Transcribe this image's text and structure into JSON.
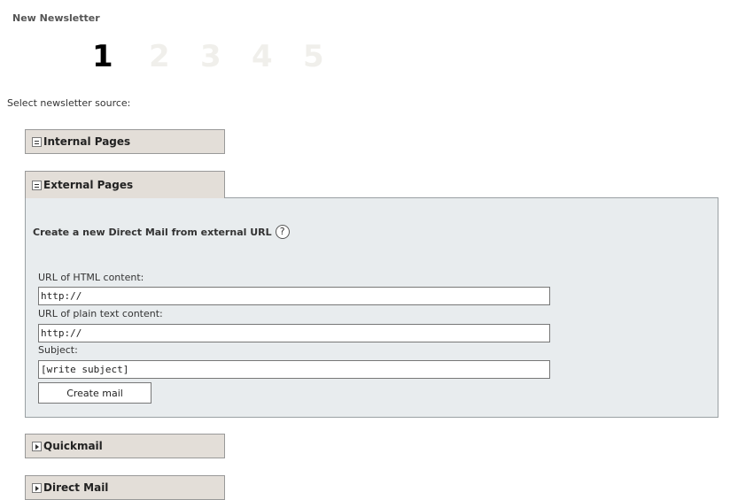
{
  "page": {
    "title": "New Newsletter",
    "source_label": "Select newsletter source:"
  },
  "steps": [
    {
      "label": "1",
      "active": true
    },
    {
      "label": "2",
      "active": false
    },
    {
      "label": "3",
      "active": false
    },
    {
      "label": "4",
      "active": false
    },
    {
      "label": "5",
      "active": false
    }
  ],
  "sections": {
    "internal": {
      "label": "Internal Pages",
      "icon": "collapse-icon"
    },
    "external": {
      "label": "External Pages",
      "icon": "collapse-icon"
    },
    "quickmail": {
      "label": "Quickmail",
      "icon": "expand-icon"
    },
    "directmail": {
      "label": "Direct Mail",
      "icon": "expand-icon"
    }
  },
  "external_form": {
    "heading": "Create a new Direct Mail from external URL",
    "help_icon": "?",
    "html_url_label": "URL of HTML content:",
    "html_url_value": "http://",
    "plain_url_label": "URL of plain text content:",
    "plain_url_value": "http://",
    "subject_label": "Subject:",
    "subject_value": "[write subject]",
    "create_button": "Create mail"
  },
  "colors": {
    "section_header_bg": "#e3ded8",
    "panel_bg": "#e8ecee",
    "active_step": "#000000",
    "inactive_step": "#f0efeb"
  }
}
